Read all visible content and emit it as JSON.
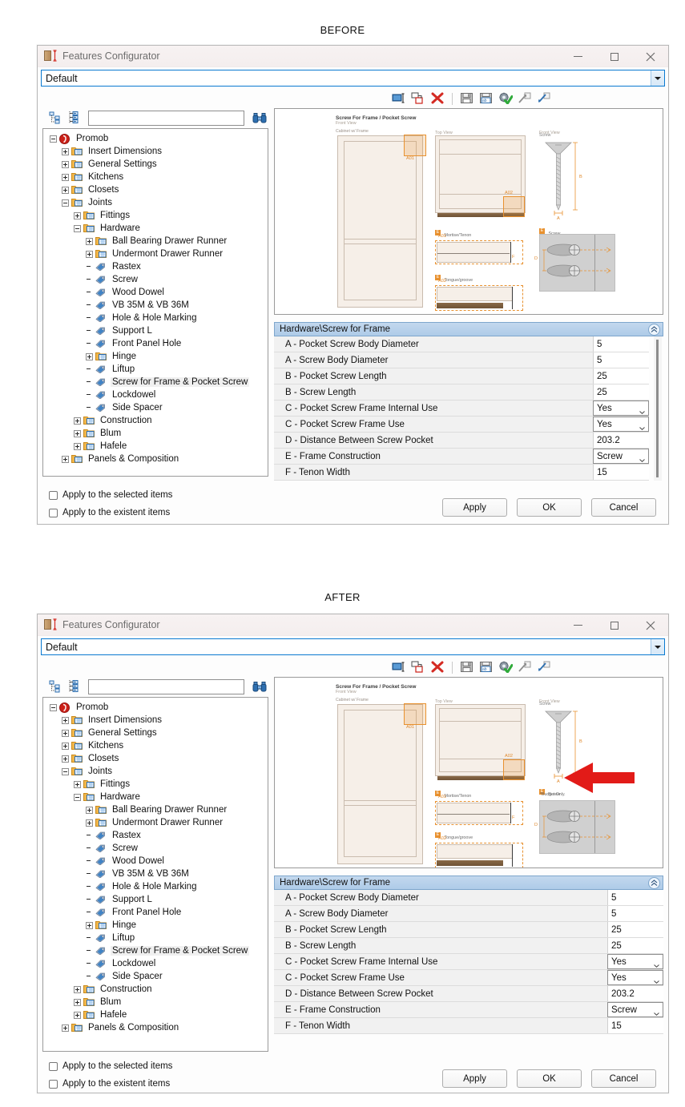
{
  "labels": {
    "before": "BEFORE",
    "after": "AFTER"
  },
  "window": {
    "title": "Features Configurator",
    "icon": "cabinet-dimension-icon",
    "controls": {
      "minimize": "minimize-icon",
      "maximize": "maximize-icon",
      "close": "close-icon"
    }
  },
  "combo": {
    "value": "Default"
  },
  "toolbar": {
    "icons": [
      "rename-icon",
      "duplicate-icon",
      "delete-icon",
      "save-icon",
      "save-as-icon",
      "settings-apply-icon",
      "export-icon",
      "import-icon"
    ]
  },
  "left_tools": {
    "collapse_all": "collapse-all-icon",
    "expand_all": "expand-all-icon",
    "search_value": "",
    "search_placeholder": "",
    "find_icon": "binoculars-icon"
  },
  "tree": [
    {
      "label": "Promob",
      "depth": 0,
      "state": "expanded",
      "icon": "promob-icon"
    },
    {
      "label": "Insert Dimensions",
      "depth": 1,
      "state": "collapsed",
      "icon": "folder-icon"
    },
    {
      "label": "General Settings",
      "depth": 1,
      "state": "collapsed",
      "icon": "folder-icon"
    },
    {
      "label": "Kitchens",
      "depth": 1,
      "state": "collapsed",
      "icon": "folder-icon"
    },
    {
      "label": "Closets",
      "depth": 1,
      "state": "collapsed",
      "icon": "folder-icon"
    },
    {
      "label": "Joints",
      "depth": 1,
      "state": "expanded",
      "icon": "folder-icon"
    },
    {
      "label": "Fittings",
      "depth": 2,
      "state": "collapsed",
      "icon": "folder-icon"
    },
    {
      "label": "Hardware",
      "depth": 2,
      "state": "expanded",
      "icon": "folder-icon"
    },
    {
      "label": "Ball Bearing Drawer Runner",
      "depth": 3,
      "state": "collapsed",
      "icon": "folder-icon"
    },
    {
      "label": "Undermont Drawer Runner",
      "depth": 3,
      "state": "collapsed",
      "icon": "folder-icon"
    },
    {
      "label": "Rastex",
      "depth": 3,
      "state": "leaf",
      "icon": "tag-icon"
    },
    {
      "label": "Screw",
      "depth": 3,
      "state": "leaf",
      "icon": "tag-icon"
    },
    {
      "label": "Wood Dowel",
      "depth": 3,
      "state": "leaf",
      "icon": "tag-icon"
    },
    {
      "label": "VB 35M & VB 36M",
      "depth": 3,
      "state": "leaf",
      "icon": "tag-icon"
    },
    {
      "label": "Hole & Hole Marking",
      "depth": 3,
      "state": "leaf",
      "icon": "tag-icon"
    },
    {
      "label": "Support L",
      "depth": 3,
      "state": "leaf",
      "icon": "tag-icon"
    },
    {
      "label": "Front Panel Hole",
      "depth": 3,
      "state": "leaf",
      "icon": "tag-icon"
    },
    {
      "label": "Hinge",
      "depth": 3,
      "state": "collapsed",
      "icon": "folder-icon"
    },
    {
      "label": "Liftup",
      "depth": 3,
      "state": "leaf",
      "icon": "tag-icon"
    },
    {
      "label": "Screw for Frame & Pocket Screw",
      "depth": 3,
      "state": "leaf",
      "icon": "tag-icon",
      "selected": true
    },
    {
      "label": "Lockdowel",
      "depth": 3,
      "state": "leaf",
      "icon": "tag-icon"
    },
    {
      "label": "Side Spacer",
      "depth": 3,
      "state": "leaf",
      "icon": "tag-icon"
    },
    {
      "label": "Construction",
      "depth": 2,
      "state": "collapsed",
      "icon": "folder-icon"
    },
    {
      "label": "Blum",
      "depth": 2,
      "state": "collapsed",
      "icon": "folder-icon"
    },
    {
      "label": "Hafele",
      "depth": 2,
      "state": "collapsed",
      "icon": "folder-icon"
    },
    {
      "label": "Panels & Composition",
      "depth": 1,
      "state": "collapsed",
      "icon": "folder-icon"
    }
  ],
  "diagram": {
    "title": "Screw For Frame / Pocket Screw",
    "col1": {
      "view": "Front View",
      "caption": "Cabinet w/ Frame",
      "code": "A01"
    },
    "col2": {
      "view": "Top View",
      "code": "A02",
      "detail1": {
        "badge": "E",
        "label": "Mortise/Tenon",
        "code": "A01",
        "dim": "F"
      },
      "detail2": {
        "badge": "E",
        "label": "Tongue/groove",
        "code": "A02"
      }
    },
    "col3": {
      "view": "Front View",
      "caption": "Screw",
      "dim_b": "B",
      "dim_a": "A",
      "detail": {
        "badge": "E",
        "label": "Screw",
        "dim": "D"
      },
      "note_after": "*Budget Only."
    }
  },
  "props": {
    "header": "Hardware\\Screw for Frame",
    "collapse_icon": "chevron-double-up-icon",
    "rows": [
      {
        "name": "A - Pocket Screw Body Diameter",
        "value": "5",
        "type": "text"
      },
      {
        "name": "A - Screw Body Diameter",
        "value": "5",
        "type": "text"
      },
      {
        "name": "B - Pocket Screw Length",
        "value": "25",
        "type": "text"
      },
      {
        "name": "B - Screw Length",
        "value": "25",
        "type": "text"
      },
      {
        "name": "C - Pocket Screw Frame Internal Use",
        "value": "Yes",
        "type": "dropdown"
      },
      {
        "name": "C - Pocket Screw Frame Use",
        "value": "Yes",
        "type": "dropdown"
      },
      {
        "name": "D - Distance Between Screw Pocket",
        "value": "203.2",
        "type": "text"
      },
      {
        "name": "E - Frame Construction",
        "value": "Screw",
        "type": "dropdown"
      },
      {
        "name": "F - Tenon Width",
        "value": "15",
        "type": "text"
      }
    ]
  },
  "footer": {
    "check1": "Apply to the selected items",
    "check2": "Apply to the existent items",
    "apply": "Apply",
    "ok": "OK",
    "cancel": "Cancel"
  },
  "colors": {
    "accent_orange": "#e8912f",
    "header_blue": "#aecbe8",
    "annotation_red": "#e21b18",
    "combo_border": "#0a7ad1"
  }
}
